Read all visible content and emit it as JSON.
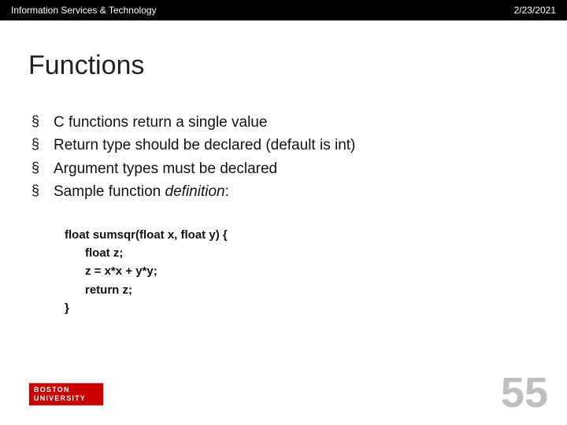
{
  "header": {
    "left": "Information Services & Technology",
    "right": "2/23/2021"
  },
  "title": "Functions",
  "bullets": [
    "C functions return a single value",
    "Return type should be declared (default is int)",
    "Argument types must be declared"
  ],
  "bullet4_prefix": "Sample function ",
  "bullet4_italic": "definition",
  "bullet4_suffix": ":",
  "code": {
    "l1": "float sumsqr(float x, float y) {",
    "l2": "float z;",
    "l3": "z = x*x + y*y;",
    "l4": "return z;",
    "l5": "}"
  },
  "logo": {
    "line1": "BOSTON",
    "line2": "UNIVERSITY"
  },
  "page_number": "55"
}
